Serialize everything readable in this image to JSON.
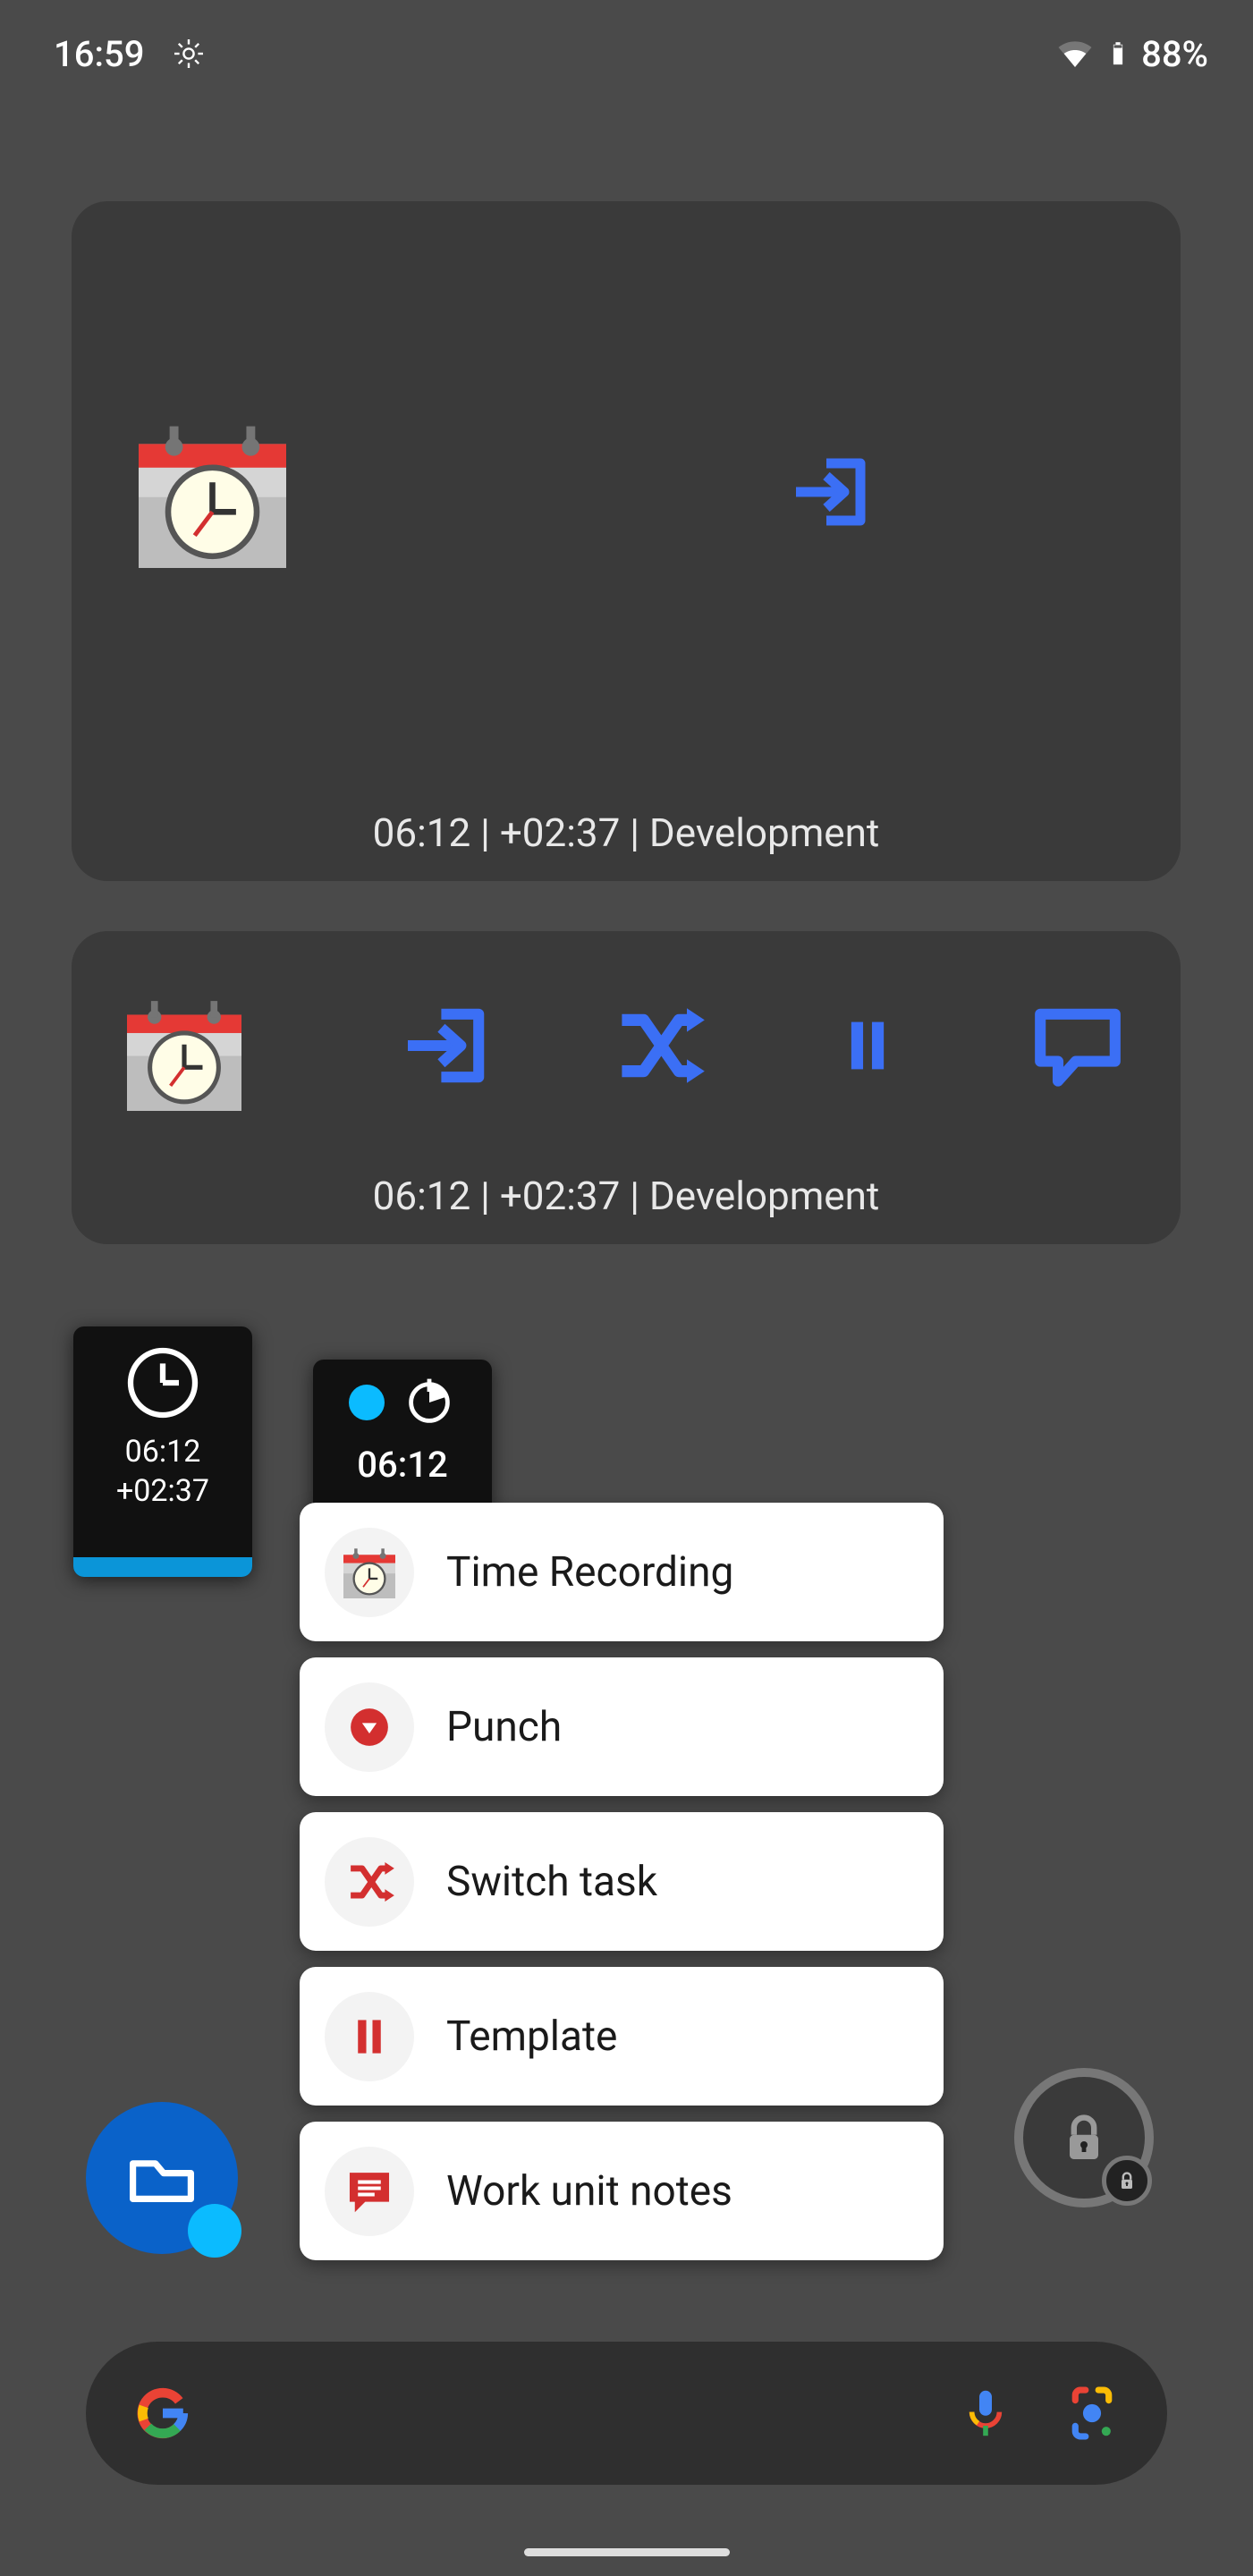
{
  "status": {
    "time": "16:59",
    "battery_pct": "88%"
  },
  "widget_large": {
    "status_line": "06:12 | +02:37 | Development"
  },
  "widget_mid": {
    "status_line": "06:12 | +02:37 | Development"
  },
  "mini1": {
    "line1": "06:12",
    "line2": "+02:37"
  },
  "mini2": {
    "time": "06:12"
  },
  "menu": {
    "items": [
      {
        "label": "Time Recording"
      },
      {
        "label": "Punch"
      },
      {
        "label": "Switch task"
      },
      {
        "label": "Template"
      },
      {
        "label": "Work unit notes"
      }
    ]
  }
}
